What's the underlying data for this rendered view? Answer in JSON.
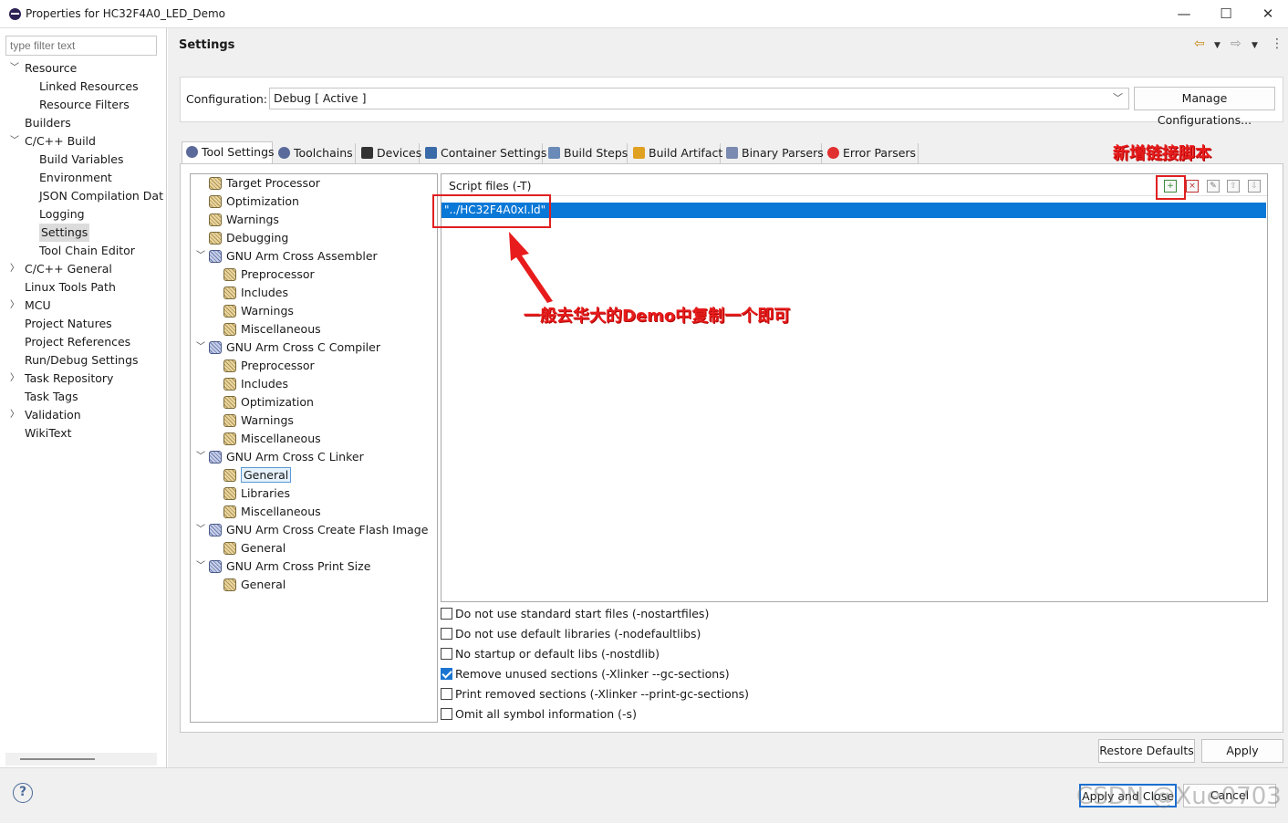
{
  "window": {
    "title": "Properties for HC32F4A0_LED_Demo",
    "minimize": "—",
    "maximize": "☐",
    "close": "✕"
  },
  "filter": {
    "placeholder": "type filter text"
  },
  "nav": [
    {
      "label": "Resource",
      "indent": 0,
      "twisty": "v"
    },
    {
      "label": "Linked Resources",
      "indent": 1
    },
    {
      "label": "Resource Filters",
      "indent": 1
    },
    {
      "label": "Builders",
      "indent": 0
    },
    {
      "label": "C/C++ Build",
      "indent": 0,
      "twisty": "v"
    },
    {
      "label": "Build Variables",
      "indent": 1
    },
    {
      "label": "Environment",
      "indent": 1
    },
    {
      "label": "JSON Compilation Dat",
      "indent": 1
    },
    {
      "label": "Logging",
      "indent": 1
    },
    {
      "label": "Settings",
      "indent": 1,
      "selected": true
    },
    {
      "label": "Tool Chain Editor",
      "indent": 1
    },
    {
      "label": "C/C++ General",
      "indent": 0,
      "twisty": ">"
    },
    {
      "label": "Linux Tools Path",
      "indent": 0
    },
    {
      "label": "MCU",
      "indent": 0,
      "twisty": ">"
    },
    {
      "label": "Project Natures",
      "indent": 0
    },
    {
      "label": "Project References",
      "indent": 0
    },
    {
      "label": "Run/Debug Settings",
      "indent": 0
    },
    {
      "label": "Task Repository",
      "indent": 0,
      "twisty": ">"
    },
    {
      "label": "Task Tags",
      "indent": 0
    },
    {
      "label": "Validation",
      "indent": 0,
      "twisty": ">"
    },
    {
      "label": "WikiText",
      "indent": 0
    }
  ],
  "page": {
    "title": "Settings"
  },
  "config": {
    "label": "Configuration:",
    "value": "Debug  [ Active ]",
    "manage_button": "Manage Configurations..."
  },
  "tabs": [
    {
      "label": "Tool Settings",
      "icon": "gear-icon",
      "color": "#5a6a9a"
    },
    {
      "label": "Toolchains",
      "icon": "gear-icon",
      "color": "#5a6a9a"
    },
    {
      "label": "Devices",
      "icon": "chip-icon",
      "color": "#333333"
    },
    {
      "label": "Container Settings",
      "icon": "container-icon",
      "color": "#3a6aa8"
    },
    {
      "label": "Build Steps",
      "icon": "wrench-icon",
      "color": "#6a8ab8"
    },
    {
      "label": "Build Artifact",
      "icon": "trophy-icon",
      "color": "#e0a020"
    },
    {
      "label": "Binary Parsers",
      "icon": "binary-icon",
      "color": "#7a8ab0"
    },
    {
      "label": "Error Parsers",
      "icon": "error-icon",
      "color": "#e03030"
    }
  ],
  "tool_tree": [
    {
      "label": "Target Processor",
      "level": 1
    },
    {
      "label": "Optimization",
      "level": 1
    },
    {
      "label": "Warnings",
      "level": 1
    },
    {
      "label": "Debugging",
      "level": 1
    },
    {
      "label": "GNU Arm Cross Assembler",
      "level": 1,
      "group": true
    },
    {
      "label": "Preprocessor",
      "level": 2
    },
    {
      "label": "Includes",
      "level": 2
    },
    {
      "label": "Warnings",
      "level": 2
    },
    {
      "label": "Miscellaneous",
      "level": 2
    },
    {
      "label": "GNU Arm Cross C Compiler",
      "level": 1,
      "group": true
    },
    {
      "label": "Preprocessor",
      "level": 2
    },
    {
      "label": "Includes",
      "level": 2
    },
    {
      "label": "Optimization",
      "level": 2
    },
    {
      "label": "Warnings",
      "level": 2
    },
    {
      "label": "Miscellaneous",
      "level": 2
    },
    {
      "label": "GNU Arm Cross C Linker",
      "level": 1,
      "group": true
    },
    {
      "label": "General",
      "level": 2,
      "selected": true
    },
    {
      "label": "Libraries",
      "level": 2
    },
    {
      "label": "Miscellaneous",
      "level": 2
    },
    {
      "label": "GNU Arm Cross Create Flash Image",
      "level": 1,
      "group": true
    },
    {
      "label": "General",
      "level": 2
    },
    {
      "label": "GNU Arm Cross Print Size",
      "level": 1,
      "group": true
    },
    {
      "label": "General",
      "level": 2
    }
  ],
  "script": {
    "header": "Script files (-T)",
    "item": "\"../HC32F4A0xI.ld\""
  },
  "checkboxes": [
    {
      "label": "Do not use standard start files (-nostartfiles)",
      "checked": false
    },
    {
      "label": "Do not use default libraries (-nodefaultlibs)",
      "checked": false
    },
    {
      "label": "No startup or default libs (-nostdlib)",
      "checked": false
    },
    {
      "label": "Remove unused sections (-Xlinker --gc-sections)",
      "checked": true
    },
    {
      "label": "Print removed sections (-Xlinker --print-gc-sections)",
      "checked": false
    },
    {
      "label": "Omit all symbol information (-s)",
      "checked": false
    }
  ],
  "buttons": {
    "restore": "Restore Defaults",
    "apply": "Apply",
    "apply_close": "Apply and Close",
    "cancel": "Cancel"
  },
  "annotations": {
    "add_script": "新增链接脚本",
    "copy_hint": "一般去华大的Demo中复制一个即可"
  },
  "watermark": "CSDN @Xue0703",
  "colors": {
    "selection": "#0a78d7",
    "annotation": "#e81c1c"
  }
}
